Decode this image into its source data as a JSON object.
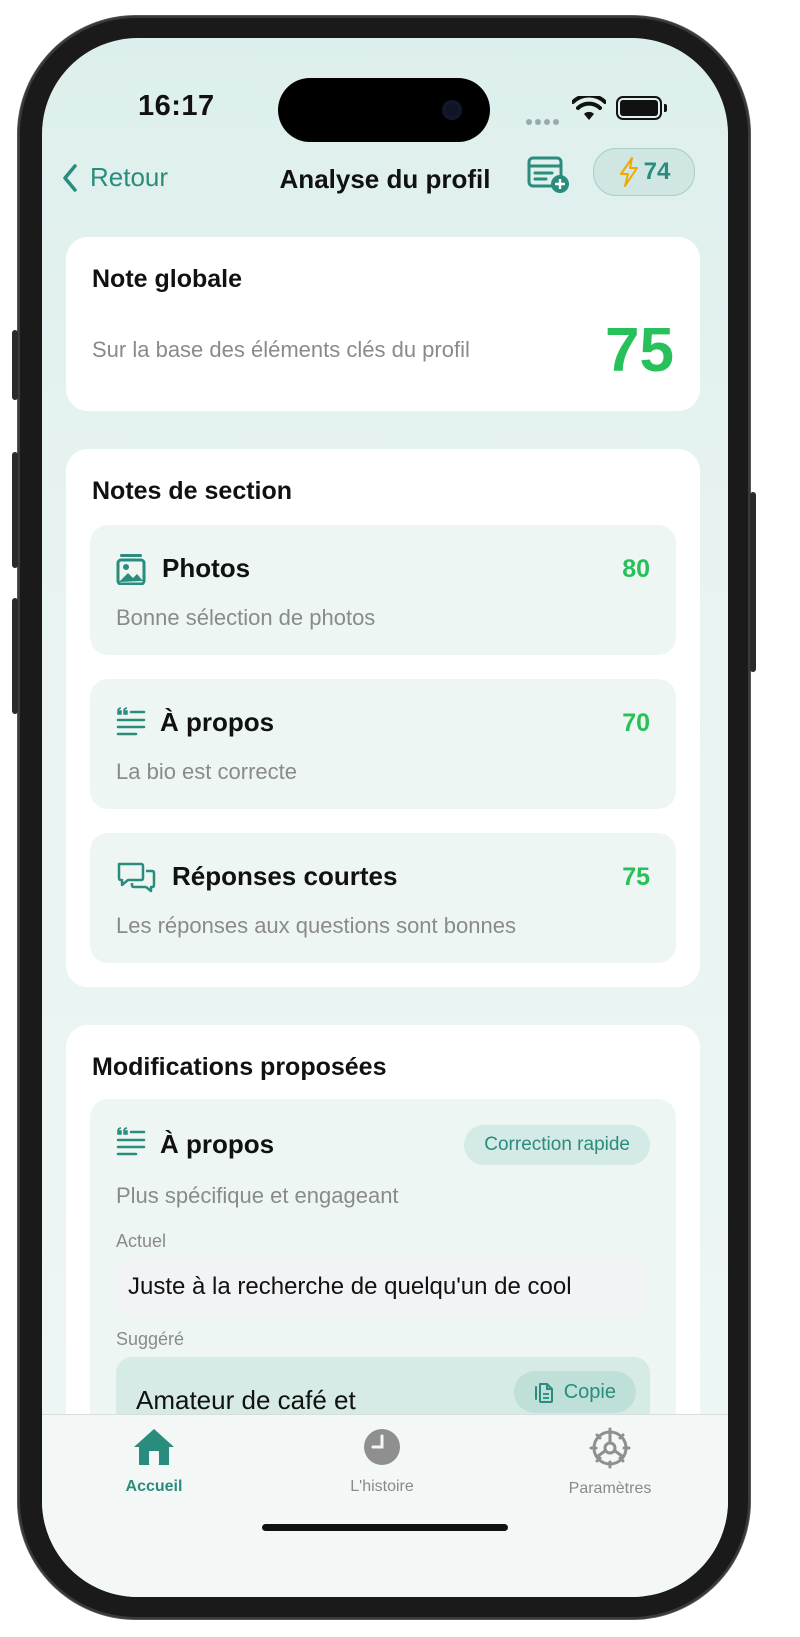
{
  "status": {
    "time": "16:17"
  },
  "nav": {
    "back_label": "Retour",
    "title": "Analyse du profil",
    "credits": "74"
  },
  "overall": {
    "title": "Note globale",
    "subtitle": "Sur la base des éléments clés du profil",
    "score": "75",
    "score_color": "#27c05a"
  },
  "sections": {
    "title": "Notes de section",
    "items": [
      {
        "icon": "photo-icon",
        "name": "Photos",
        "score": "80",
        "desc": "Bonne sélection de photos"
      },
      {
        "icon": "text-lines-icon",
        "name": "À propos",
        "score": "70",
        "desc": "La bio est correcte"
      },
      {
        "icon": "chat-bubbles-icon",
        "name": "Réponses courtes",
        "score": "75",
        "desc": "Les réponses aux questions sont bonnes"
      }
    ]
  },
  "modifications": {
    "title": "Modifications proposées",
    "item": {
      "icon": "text-lines-icon",
      "name": "À propos",
      "chip": "Correction rapide",
      "desc": "Plus spécifique et engageant",
      "current_label": "Actuel",
      "current_text": "Juste à la recherche de quelqu'un de cool",
      "suggested_label": "Suggéré",
      "suggested_text": "Amateur de café et",
      "copy_label": "Copie"
    }
  },
  "tabbar": {
    "tabs": [
      {
        "icon": "home-icon",
        "label": "Accueil",
        "active": true
      },
      {
        "icon": "clock-icon",
        "label": "L'histoire",
        "active": false
      },
      {
        "icon": "gear-icon",
        "label": "Paramètres",
        "active": false
      }
    ]
  },
  "colors": {
    "accent": "#2a8c7c",
    "score_green": "#27c05a",
    "background": "#e6f2f0"
  }
}
